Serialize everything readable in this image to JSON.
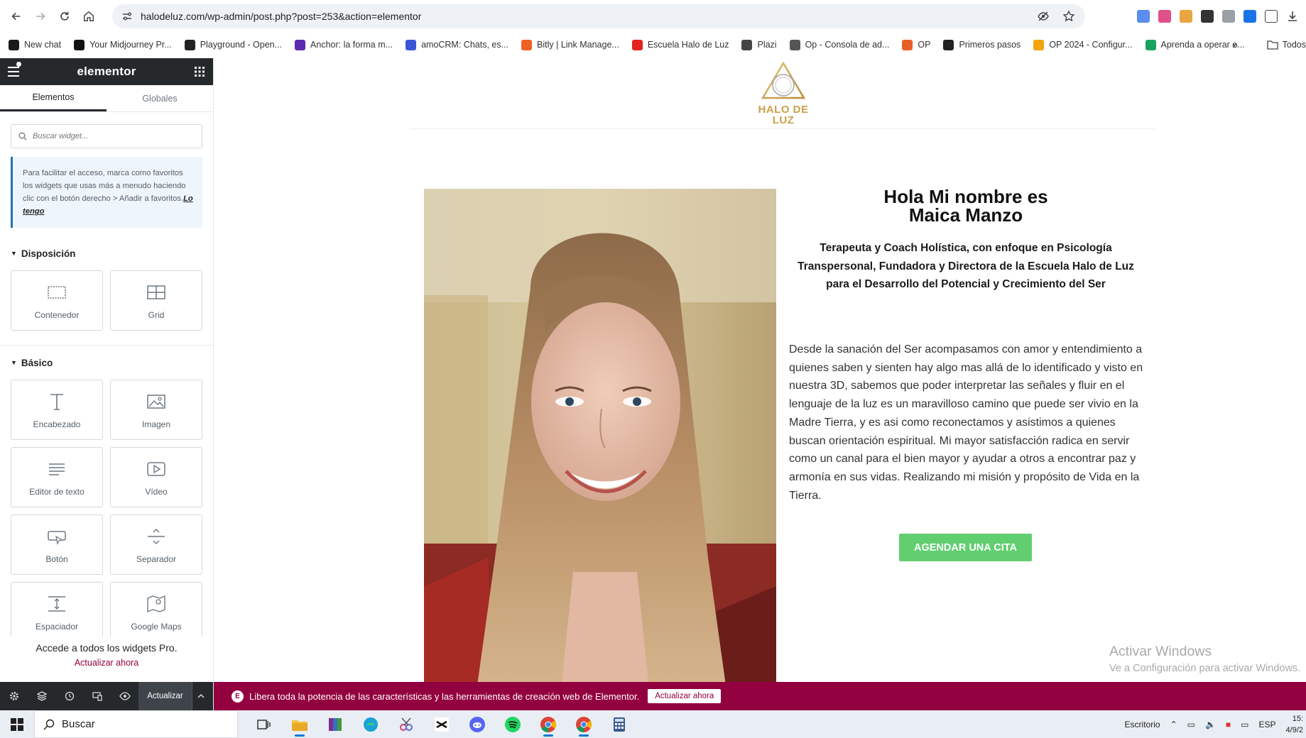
{
  "browser": {
    "url": "halodeluz.com/wp-admin/post.php?post=253&action=elementor",
    "bookmarks": [
      {
        "label": "New chat",
        "color": "#1a1a1a"
      },
      {
        "label": "Your Midjourney Pr...",
        "color": "#111111"
      },
      {
        "label": "Playground - Open...",
        "color": "#222222"
      },
      {
        "label": "Anchor: la forma m...",
        "color": "#5b2ab0"
      },
      {
        "label": "amoCRM: Chats, es...",
        "color": "#3a55d8"
      },
      {
        "label": "Bitly | Link Manage...",
        "color": "#ee6123"
      },
      {
        "label": "Escuela Halo de Luz",
        "color": "#e2241a"
      },
      {
        "label": "Plazi",
        "color": "#444444"
      },
      {
        "label": "Op - Consola de ad...",
        "color": "#555555"
      },
      {
        "label": "OP",
        "color": "#e65f28"
      },
      {
        "label": "Primeros pasos",
        "color": "#222222"
      },
      {
        "label": "OP 2024 - Configur...",
        "color": "#f2a50c"
      },
      {
        "label": "Aprenda a operar e...",
        "color": "#1aa260"
      }
    ],
    "bookmarks_more": "»",
    "bookmarks_all": "Todos"
  },
  "panel": {
    "brand": "elementor",
    "tabs": [
      "Elementos",
      "Globales"
    ],
    "search_placeholder": "Buscar widget...",
    "notice_text": "Para facilitar el acceso, marca como favoritos los widgets que usas más a menudo haciendo clic con el botón derecho > Añadir a favoritos.",
    "notice_link": "Lo tengo",
    "section_layout": "Disposición",
    "layout_widgets": [
      {
        "label": "Contenedor",
        "icon": "container-icon"
      },
      {
        "label": "Grid",
        "icon": "grid-icon"
      }
    ],
    "section_basic": "Básico",
    "basic_widgets": [
      {
        "label": "Encabezado",
        "icon": "heading-icon"
      },
      {
        "label": "Imagen",
        "icon": "image-icon"
      },
      {
        "label": "Editor de texto",
        "icon": "text-editor-icon"
      },
      {
        "label": "Vídeo",
        "icon": "video-icon"
      },
      {
        "label": "Botón",
        "icon": "button-icon"
      },
      {
        "label": "Separador",
        "icon": "divider-icon"
      },
      {
        "label": "Espaciador",
        "icon": "spacer-icon"
      },
      {
        "label": "Google Maps",
        "icon": "map-icon"
      }
    ],
    "pro_text": "Accede a todos los widgets Pro.",
    "pro_link": "Actualizar ahora",
    "footer_update": "Actualizar"
  },
  "page": {
    "logo_line1": "HALO DE",
    "logo_line2": "LUZ",
    "title_line1": "Hola Mi nombre es",
    "title_line2": "Maica Manzo",
    "subtitle": "Terapeuta y Coach Holística, con enfoque en Psicología Transpersonal, Fundadora y Directora de la Escuela Halo de Luz para el Desarrollo del Potencial y Crecimiento del Ser",
    "body": "Desde la sanación del Ser acompasamos con amor y entendimiento a quienes saben y sienten hay algo mas allá de lo identificado y visto en nuestra 3D, sabemos que poder interpretar las señales y fluir en el lenguaje de la luz es un maravilloso camino que puede ser vivio en la Madre Tierra, y es asi como reconectamos y asistimos a quienes buscan orientación espiritual. Mi mayor satisfacción radica en servir como un canal para el bien mayor y ayudar a otros a encontrar paz y armonía en sus vidas. Realizando mi misión y propósito de Vida en la Tierra.",
    "cta": "AGENDAR UNA CITA"
  },
  "promo": {
    "text": "Libera toda la potencia de las características y las herramientas de creación web de Elementor.",
    "button": "Actualizar ahora"
  },
  "watermark": {
    "line1": "Activar Windows",
    "line2": "Ve a Configuración para activar Windows."
  },
  "taskbar": {
    "search": "Buscar",
    "desktop": "Escritorio",
    "lang": "ESP",
    "time": "15:",
    "date": "4/9/2"
  },
  "colors": {
    "elementor_dark": "#26292c",
    "accent": "#93003f",
    "cta_green": "#61ce70",
    "logo_gold": "#c8a048"
  }
}
